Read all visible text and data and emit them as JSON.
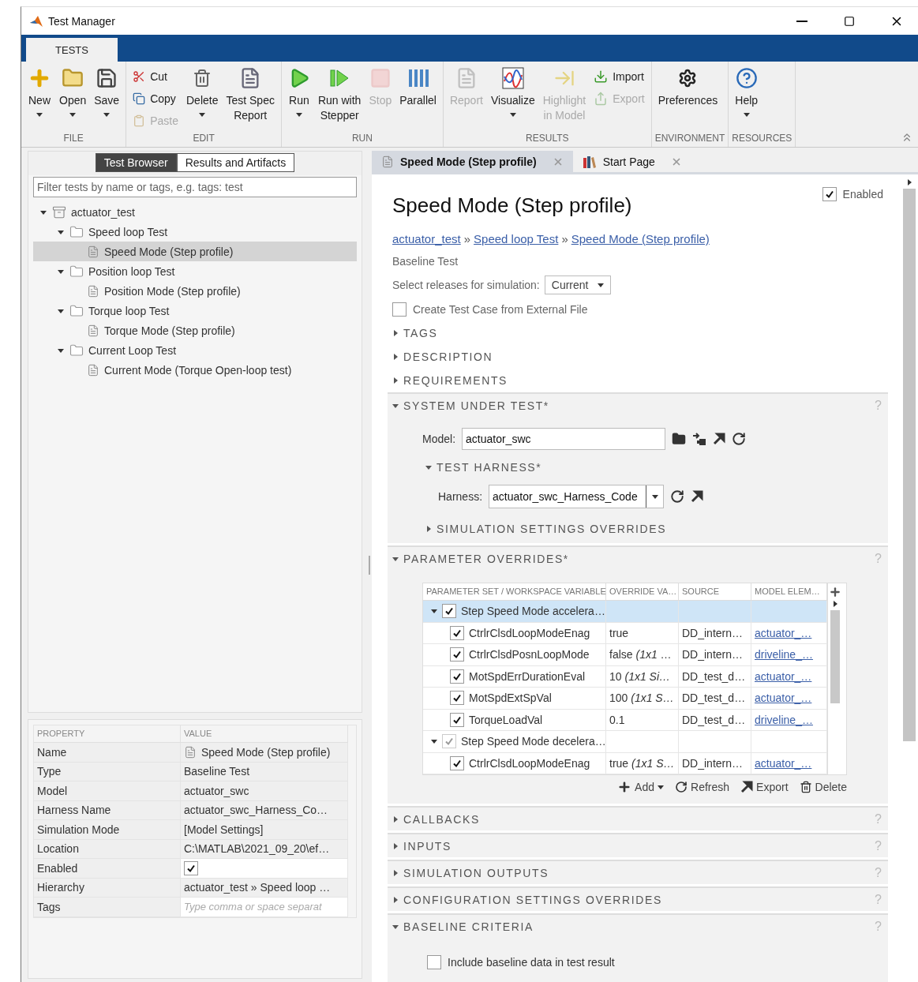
{
  "window": {
    "title": "Test Manager"
  },
  "ribbon_tabs": [
    {
      "label": "TESTS",
      "selected": true
    }
  ],
  "toolbar": {
    "groups": [
      {
        "label": "FILE",
        "columns": [
          {
            "kind": "large",
            "label": "New",
            "dropdown": true,
            "disabled": false
          },
          {
            "kind": "large",
            "label": "Open",
            "dropdown": true,
            "disabled": false
          },
          {
            "kind": "large",
            "label": "Save",
            "dropdown": true,
            "disabled": false
          }
        ]
      },
      {
        "label": "EDIT",
        "columns": [
          {
            "kind": "stack",
            "items": [
              {
                "label": "Cut",
                "disabled": false
              },
              {
                "label": "Copy",
                "disabled": false
              },
              {
                "label": "Paste",
                "disabled": true
              }
            ]
          },
          {
            "kind": "large",
            "label": "Delete",
            "dropdown": true,
            "disabled": false
          },
          {
            "kind": "large",
            "label": "Test Spec\nReport",
            "dropdown": false,
            "disabled": false
          }
        ]
      },
      {
        "label": "RUN",
        "columns": [
          {
            "kind": "large",
            "label": "Run",
            "dropdown": true,
            "disabled": false
          },
          {
            "kind": "large",
            "label": "Run with\nStepper",
            "dropdown": false,
            "disabled": false
          },
          {
            "kind": "large",
            "label": "Stop",
            "dropdown": false,
            "disabled": true
          },
          {
            "kind": "large",
            "label": "Parallel",
            "dropdown": false,
            "disabled": false
          }
        ]
      },
      {
        "label": "RESULTS",
        "columns": [
          {
            "kind": "large",
            "label": "Report",
            "dropdown": false,
            "disabled": true
          },
          {
            "kind": "large",
            "label": "Visualize",
            "dropdown": true,
            "disabled": false
          },
          {
            "kind": "large",
            "label": "Highlight\nin Model",
            "dropdown": false,
            "disabled": true
          },
          {
            "kind": "stack",
            "items": [
              {
                "label": "Import",
                "disabled": false
              },
              {
                "label": "Export",
                "disabled": true
              }
            ]
          }
        ]
      },
      {
        "label": "ENVIRONMENT",
        "columns": [
          {
            "kind": "large",
            "label": "Preferences",
            "dropdown": false,
            "disabled": false
          }
        ]
      },
      {
        "label": "RESOURCES",
        "columns": [
          {
            "kind": "large",
            "label": "Help",
            "dropdown": true,
            "disabled": false
          }
        ]
      }
    ]
  },
  "browser": {
    "tabs": [
      {
        "label": "Test Browser",
        "selected": true
      },
      {
        "label": "Results and Artifacts",
        "selected": false
      }
    ],
    "filter": {
      "placeholder": "Filter tests by name or tags, e.g. tags: test"
    },
    "tree": [
      {
        "label": "actuator_test",
        "kind": "suite",
        "expanded": true,
        "selected": false,
        "children": [
          {
            "label": "Speed loop Test",
            "kind": "folder",
            "expanded": true,
            "selected": false,
            "children": [
              {
                "label": "Speed Mode (Step profile)",
                "kind": "file",
                "selected": true
              }
            ]
          },
          {
            "label": "Position loop Test",
            "kind": "folder",
            "expanded": true,
            "selected": false,
            "children": [
              {
                "label": "Position Mode (Step profile)",
                "kind": "file",
                "selected": false
              }
            ]
          },
          {
            "label": "Torque loop Test",
            "kind": "folder",
            "expanded": true,
            "selected": false,
            "children": [
              {
                "label": "Torque Mode (Step profile)",
                "kind": "file",
                "selected": false
              }
            ]
          },
          {
            "label": "Current Loop Test",
            "kind": "folder",
            "expanded": true,
            "selected": false,
            "children": [
              {
                "label": "Current Mode (Torque Open-loop test)",
                "kind": "file",
                "selected": false
              }
            ]
          }
        ]
      }
    ]
  },
  "properties": {
    "columns": [
      "PROPERTY",
      "VALUE"
    ],
    "rows": [
      {
        "property": "Name",
        "kind": "file",
        "value": "Speed Mode (Step profile)"
      },
      {
        "property": "Type",
        "kind": "text",
        "value": "Baseline Test"
      },
      {
        "property": "Model",
        "kind": "text",
        "value": "actuator_swc"
      },
      {
        "property": "Harness Name",
        "kind": "text",
        "value": "actuator_swc_Harness_Co…"
      },
      {
        "property": "Simulation Mode",
        "kind": "text",
        "value": "[Model Settings]"
      },
      {
        "property": "Location",
        "kind": "text",
        "value": "C:\\MATLAB\\2021_09_20\\ef…"
      },
      {
        "property": "Enabled",
        "kind": "checkbox",
        "checked": true
      },
      {
        "property": "Hierarchy",
        "kind": "text",
        "value": "actuator_test » Speed loop …"
      },
      {
        "property": "Tags",
        "kind": "input",
        "placeholder": "Type comma or space separat"
      }
    ]
  },
  "doc_tabs": [
    {
      "label": "Speed Mode (Step profile)",
      "selected": true
    },
    {
      "label": "Start Page",
      "selected": false
    }
  ],
  "test_case": {
    "title": "Speed Mode (Step profile)",
    "enabled": {
      "label": "Enabled",
      "checked": true
    },
    "breadcrumb": {
      "separator": "»",
      "links": [
        "actuator_test",
        "Speed loop Test",
        "Speed Mode (Step profile)"
      ]
    },
    "type": "Baseline Test",
    "releases": {
      "label": "Select releases for simulation:",
      "value": "Current"
    },
    "external_file": {
      "label": "Create Test Case from External File",
      "checked": false
    },
    "sections": [
      {
        "title": "TAGS",
        "expanded": false
      },
      {
        "title": "DESCRIPTION",
        "expanded": false
      },
      {
        "title": "REQUIREMENTS",
        "expanded": false
      },
      {
        "title": "SYSTEM UNDER TEST*",
        "expanded": true,
        "help": "?",
        "content": {
          "kind": "system_under_test",
          "model": {
            "label": "Model:",
            "value": "actuator_swc"
          },
          "subsections": [
            {
              "title": "TEST HARNESS*",
              "expanded": true,
              "field": {
                "label": "Harness:",
                "value": "actuator_swc_Harness_Code"
              }
            },
            {
              "title": "SIMULATION SETTINGS OVERRIDES",
              "expanded": false
            }
          ]
        }
      },
      {
        "title": "PARAMETER OVERRIDES*",
        "expanded": true,
        "help": "?",
        "content": {
          "kind": "parameter_overrides",
          "columns": [
            "PARAMETER SET / WORKSPACE VARIABLE",
            "OVERRIDE VA…",
            "SOURCE",
            "MODEL ELEM…"
          ],
          "groups": [
            {
              "name": "Step Speed Mode accelera…",
              "checked": true,
              "mixed": false,
              "expanded": true,
              "selected": true,
              "rows": [
                {
                  "name": "CtrlrClsdLoopModeEnag",
                  "checked": true,
                  "value": "true",
                  "source": "DD_intern…",
                  "element": "actuator_…"
                },
                {
                  "name": "CtrlrClsdPosnLoopMode",
                  "checked": true,
                  "value": "false *(1x1* …",
                  "source": "DD_intern…",
                  "element": "driveline_…"
                },
                {
                  "name": "MotSpdErrDurationEval",
                  "checked": true,
                  "value": "10 *(1x1 Si…*",
                  "source": "DD_test_d…",
                  "element": "actuator_…"
                },
                {
                  "name": "MotSpdExtSpVal",
                  "checked": true,
                  "value": "100 *(1x1 S…*",
                  "source": "DD_test_d…",
                  "element": "actuator_…"
                },
                {
                  "name": "TorqueLoadVal",
                  "checked": true,
                  "value": "0.1",
                  "source": "DD_test_d…",
                  "element": "driveline_…"
                }
              ]
            },
            {
              "name": "Step Speed Mode decelera…",
              "checked": true,
              "mixed": true,
              "expanded": true,
              "selected": false,
              "rows": [
                {
                  "name": "CtrlrClsdLoopModeEnag",
                  "checked": true,
                  "value": "true *(1x1 S…*",
                  "source": "DD_intern…",
                  "element": "actuator_…"
                }
              ]
            }
          ],
          "actions": [
            {
              "label": "Add",
              "dropdown": true
            },
            {
              "label": "Refresh",
              "dropdown": false
            },
            {
              "label": "Export",
              "dropdown": false
            },
            {
              "label": "Delete",
              "dropdown": false
            }
          ]
        }
      },
      {
        "title": "CALLBACKS",
        "expanded": false,
        "help": "?"
      },
      {
        "title": "INPUTS",
        "expanded": false,
        "help": "?"
      },
      {
        "title": "SIMULATION OUTPUTS",
        "expanded": false,
        "help": "?"
      },
      {
        "title": "CONFIGURATION SETTINGS OVERRIDES",
        "expanded": false,
        "help": "?"
      },
      {
        "title": "BASELINE CRITERIA",
        "expanded": true,
        "help": "?",
        "content": {
          "kind": "baseline_criteria",
          "checkbox": {
            "label": "Include baseline data in test result",
            "checked": false
          }
        }
      }
    ]
  }
}
